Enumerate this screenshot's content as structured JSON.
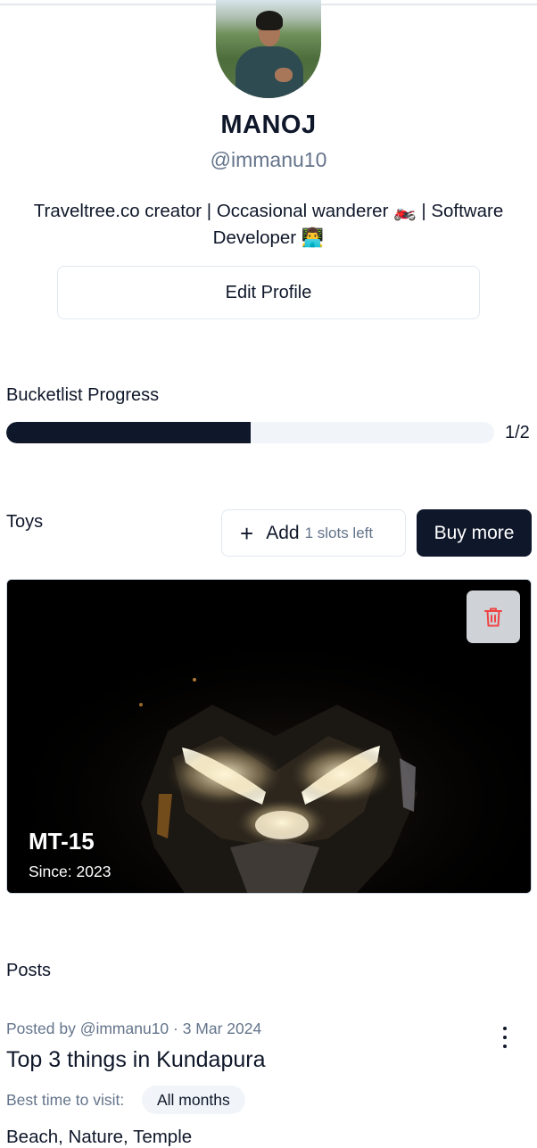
{
  "profile": {
    "name": "MANOJ",
    "handle": "@immanu10",
    "bio": "Traveltree.co creator | Occasional wanderer 🏍️ | Software Developer 👨‍💻",
    "edit_label": "Edit Profile"
  },
  "bucketlist": {
    "label": "Bucketlist Progress",
    "count": "1/2",
    "progress": 0.5
  },
  "toys": {
    "label": "Toys",
    "add_label": "Add",
    "slots_left": "1 slots left",
    "buy_label": "Buy more",
    "items": [
      {
        "title": "MT-15",
        "since": "Since: 2023"
      }
    ]
  },
  "posts": {
    "label": "Posts",
    "items": [
      {
        "meta": "Posted by @immanu10 · 3 Mar 2024",
        "title": "Top 3 things in Kundapura",
        "best_time_label": "Best time to visit:",
        "best_time_value": "All months",
        "tags": "Beach, Nature, Temple"
      }
    ]
  },
  "icons": {
    "add": "plus-icon",
    "delete": "trash-icon",
    "more": "kebab-icon"
  },
  "colors": {
    "primary": "#0f172a",
    "muted": "#64748b",
    "track": "#f1f5f9",
    "danger": "#ef4444"
  }
}
